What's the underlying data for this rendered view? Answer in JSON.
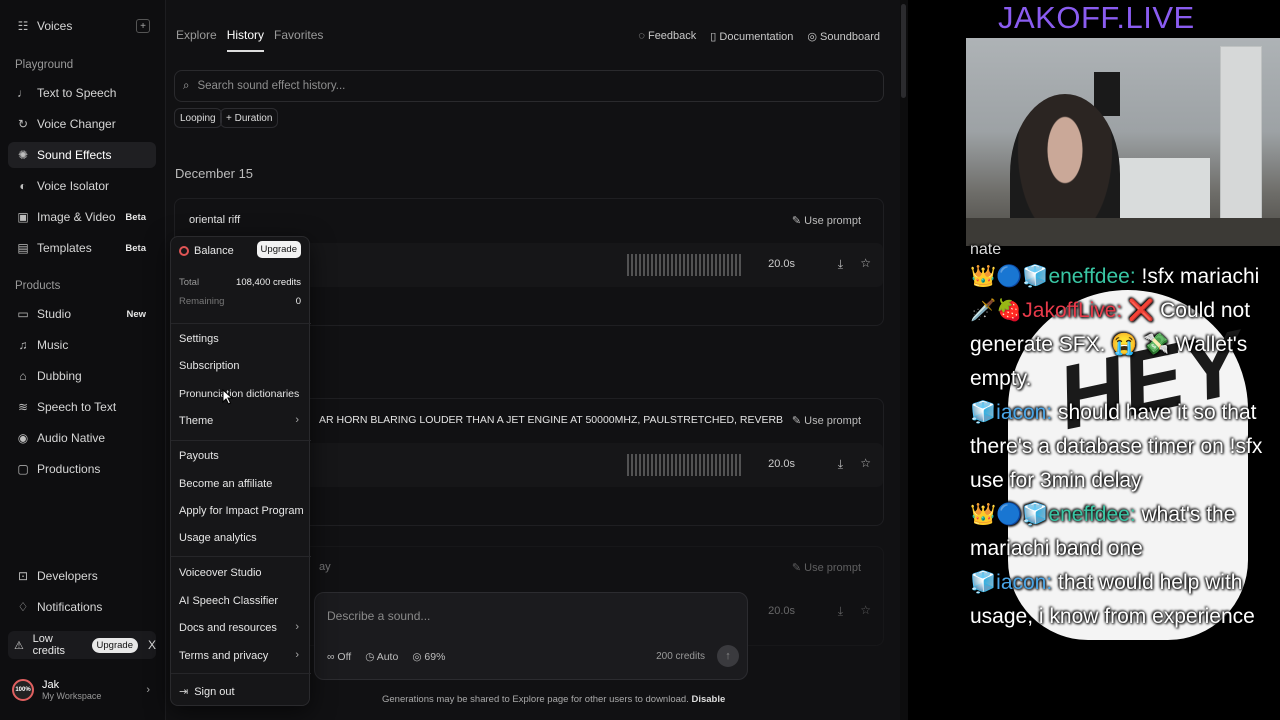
{
  "sidebar": {
    "voices": {
      "label": "Voices",
      "icon": "voices-icon",
      "add": "+"
    },
    "playground_heading": "Playground",
    "playground": [
      {
        "label": "Text to Speech",
        "icon": "tts-icon"
      },
      {
        "label": "Voice Changer",
        "icon": "voice-changer-icon"
      },
      {
        "label": "Sound Effects",
        "icon": "sound-effects-icon",
        "active": true
      },
      {
        "label": "Voice Isolator",
        "icon": "voice-isolator-icon"
      },
      {
        "label": "Image & Video",
        "icon": "image-video-icon",
        "badge": "Beta"
      },
      {
        "label": "Templates",
        "icon": "templates-icon",
        "badge": "Beta"
      }
    ],
    "products_heading": "Products",
    "products": [
      {
        "label": "Studio",
        "icon": "studio-icon",
        "badge": "New"
      },
      {
        "label": "Music",
        "icon": "music-icon"
      },
      {
        "label": "Dubbing",
        "icon": "dubbing-icon"
      },
      {
        "label": "Speech to Text",
        "icon": "speech-to-text-icon"
      },
      {
        "label": "Audio Native",
        "icon": "audio-native-icon"
      },
      {
        "label": "Productions",
        "icon": "productions-icon"
      }
    ],
    "bottom": [
      {
        "label": "Developers",
        "icon": "developers-icon"
      },
      {
        "label": "Notifications",
        "icon": "bell-icon"
      }
    ],
    "low_credits": {
      "label": "Low credits",
      "upgrade": "Upgrade",
      "close": "X"
    },
    "user": {
      "name": "Jak",
      "workspace": "My Workspace",
      "avatar_text": "100%"
    }
  },
  "main": {
    "tabs": [
      "Explore",
      "History",
      "Favorites"
    ],
    "active_tab": "History",
    "top_links": [
      "Feedback",
      "Documentation",
      "Soundboard"
    ],
    "search_placeholder": "Search sound effect history...",
    "chips": [
      "Looping",
      "+ Duration"
    ],
    "date": "December 15",
    "cards": [
      {
        "title": "oriental riff",
        "use_prompt": "Use prompt",
        "duration": "20.0s"
      },
      {
        "title": "AR HORN BLARING LOUDER THAN A JET ENGINE AT 50000MHZ, PAULSTRETCHED, REVERB",
        "use_prompt": "Use prompt",
        "duration": "20.0s"
      },
      {
        "title": "ay",
        "use_prompt": "Use prompt",
        "duration": "20.0s"
      }
    ],
    "composer": {
      "placeholder": "Describe a sound...",
      "loop": "Off",
      "duration": "Auto",
      "influence": "69%",
      "credits": "200 credits"
    },
    "footer": {
      "text": "Generations may be shared to Explore page for other users to download.",
      "action": "Disable"
    }
  },
  "menu": {
    "balance_label": "Balance",
    "upgrade": "Upgrade",
    "total_label": "Total",
    "total_value": "108,400 credits",
    "remaining_label": "Remaining",
    "remaining_value": "0",
    "items_group1": [
      "Settings",
      "Subscription",
      "Pronunciation dictionaries",
      "Theme"
    ],
    "items_group2": [
      "Payouts",
      "Become an affiliate",
      "Apply for Impact Program",
      "Usage analytics"
    ],
    "items_group3": [
      "Voiceover Studio",
      "AI Speech Classifier",
      "Docs and resources",
      "Terms and privacy"
    ],
    "sign_out": "Sign out"
  },
  "overlay": {
    "brand": "JAKOFF.LIVE",
    "cut_text": "nate",
    "messages": [
      {
        "badges": "👑🔵🧊",
        "user": "eneffdee:",
        "text": " !sfx mariachi",
        "color": "green"
      },
      {
        "badges": "🗡️🍓",
        "user": "JakoffLive:",
        "text": " ❌ Could not generate SFX. 😭 💸 Wallet's empty.",
        "color": "red"
      },
      {
        "badges": "🧊",
        "user": "iacon:",
        "text": " should have it so that there's a database timer on !sfx use for 3min delay",
        "color": "blue"
      },
      {
        "badges": "👑🔵🧊",
        "user": "eneffdee:",
        "text": " what's the mariachi band one",
        "color": "green"
      },
      {
        "badges": "🧊",
        "user": "iacon:",
        "text": " that would help with usage, i know from experience",
        "color": "blue"
      }
    ],
    "bg_text": "HEY"
  }
}
